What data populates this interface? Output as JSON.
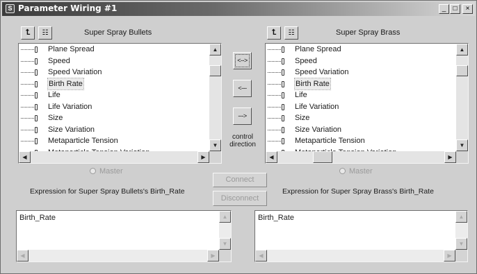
{
  "window": {
    "title": "Parameter Wiring #1",
    "app_icon": "S",
    "minimize": "_",
    "maximize": "□",
    "close": "×"
  },
  "left_panel": {
    "title": "Super Spray Bullets",
    "up_icon": "⮤",
    "lock_icon": "🔒",
    "items": [
      "Plane Spread",
      "Speed",
      "Speed Variation",
      "Birth Rate",
      "Life",
      "Life Variation",
      "Size",
      "Size Variation",
      "Metaparticle Tension",
      "Metaparticle Tension Variation"
    ],
    "selected_index": 3,
    "master_label": "Master",
    "expression_label": "Expression for Super Spray Bullets's Birth_Rate",
    "expression_text": "Birth_Rate"
  },
  "right_panel": {
    "title": "Super Spray Brass",
    "up_icon": "⮤",
    "lock_icon": "🔒",
    "items": [
      "Plane Spread",
      "Speed",
      "Speed Variation",
      "Birth Rate",
      "Life",
      "Life Variation",
      "Size",
      "Size Variation",
      "Metaparticle Tension",
      "Metaparticle Tension Variation"
    ],
    "selected_index": 3,
    "master_label": "Master",
    "expression_label": "Expression for Super Spray Brass's Birth_Rate",
    "expression_text": "Birth_Rate"
  },
  "control_direction": {
    "both": "<-->",
    "left": "<---",
    "right": "--->",
    "label_line1": "control",
    "label_line2": "direction"
  },
  "actions": {
    "connect": "Connect",
    "disconnect": "Disconnect"
  },
  "scroll": {
    "up": "▲",
    "down": "▼",
    "left": "◀",
    "right": "▶"
  }
}
